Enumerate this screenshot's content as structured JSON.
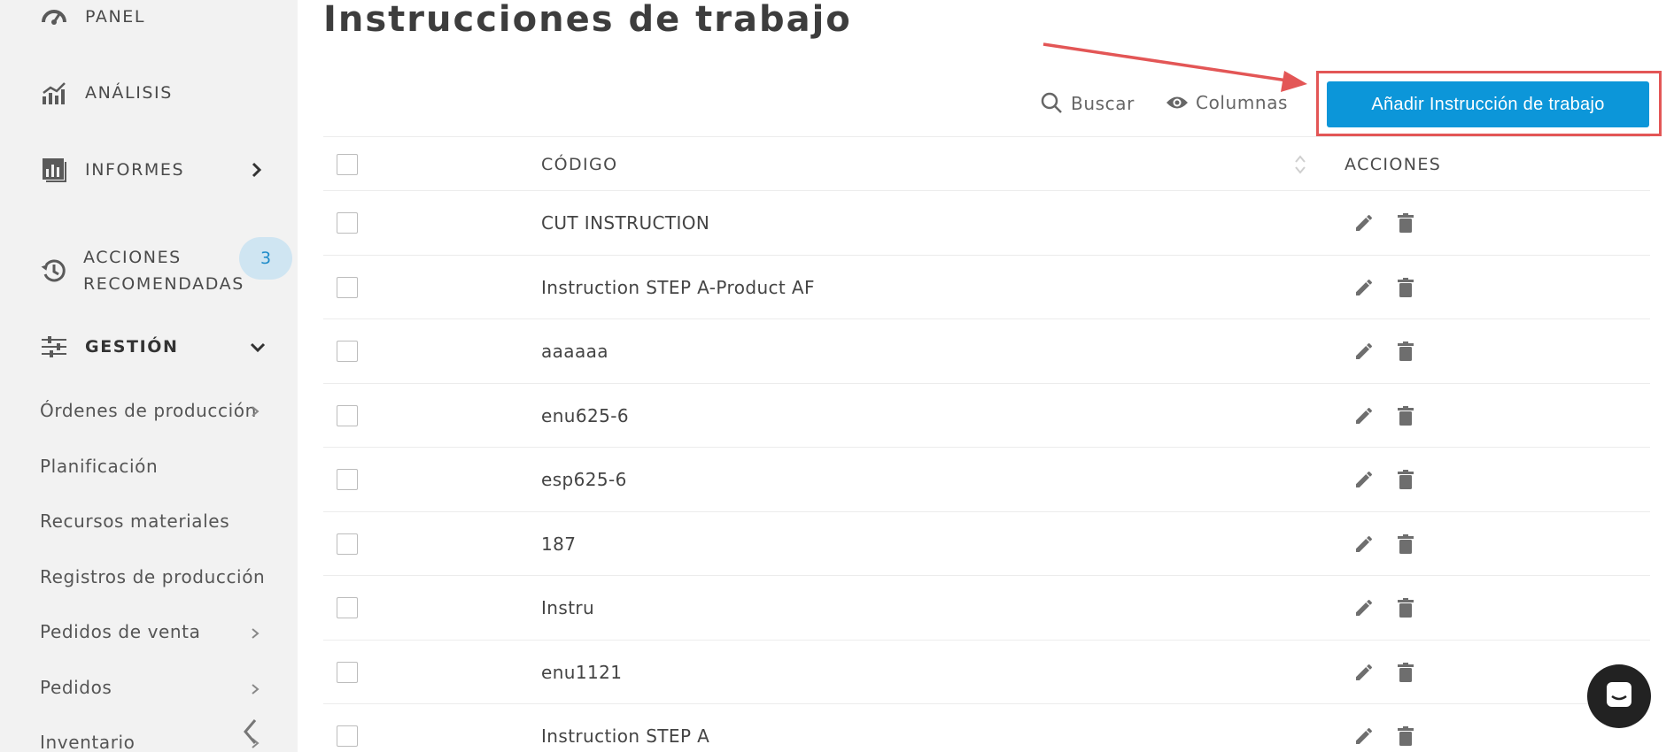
{
  "sidebar": {
    "nav": [
      {
        "label": "PANEL",
        "icon": "speedometer-icon"
      },
      {
        "label": "ANÁLISIS",
        "icon": "analytics-icon"
      },
      {
        "label": "INFORMES",
        "icon": "reports-icon"
      },
      {
        "label_line1": "ACCIONES",
        "label_line2": "RECOMENDADAS",
        "icon": "history-icon",
        "badge": "3"
      },
      {
        "label": "GESTIÓN",
        "icon": "sliders-icon"
      }
    ],
    "sub_items": [
      {
        "label": "Órdenes de producción"
      },
      {
        "label": "Planificación"
      },
      {
        "label": "Recursos materiales"
      },
      {
        "label": "Registros de producción"
      },
      {
        "label": "Pedidos de venta"
      },
      {
        "label": "Pedidos"
      },
      {
        "label": "Inventario"
      }
    ]
  },
  "main": {
    "title": "Instrucciones de trabajo",
    "toolbar": {
      "search_label": "Buscar",
      "columns_label": "Columnas",
      "add_label": "Añadir Instrucción de trabajo"
    },
    "table": {
      "headers": {
        "code": "CÓDIGO",
        "actions": "ACCIONES"
      },
      "rows": [
        {
          "code": "CUT INSTRUCTION"
        },
        {
          "code": "Instruction STEP A-Product AF"
        },
        {
          "code": "aaaaaa"
        },
        {
          "code": "enu625-6"
        },
        {
          "code": "esp625-6"
        },
        {
          "code": "187"
        },
        {
          "code": "Instru"
        },
        {
          "code": "enu1121"
        },
        {
          "code": "Instruction STEP A"
        }
      ]
    }
  },
  "colors": {
    "primary": "#0c96d9",
    "highlight": "#e35656",
    "badge_bg": "#cfe5f2",
    "badge_text": "#1f8cc9"
  }
}
